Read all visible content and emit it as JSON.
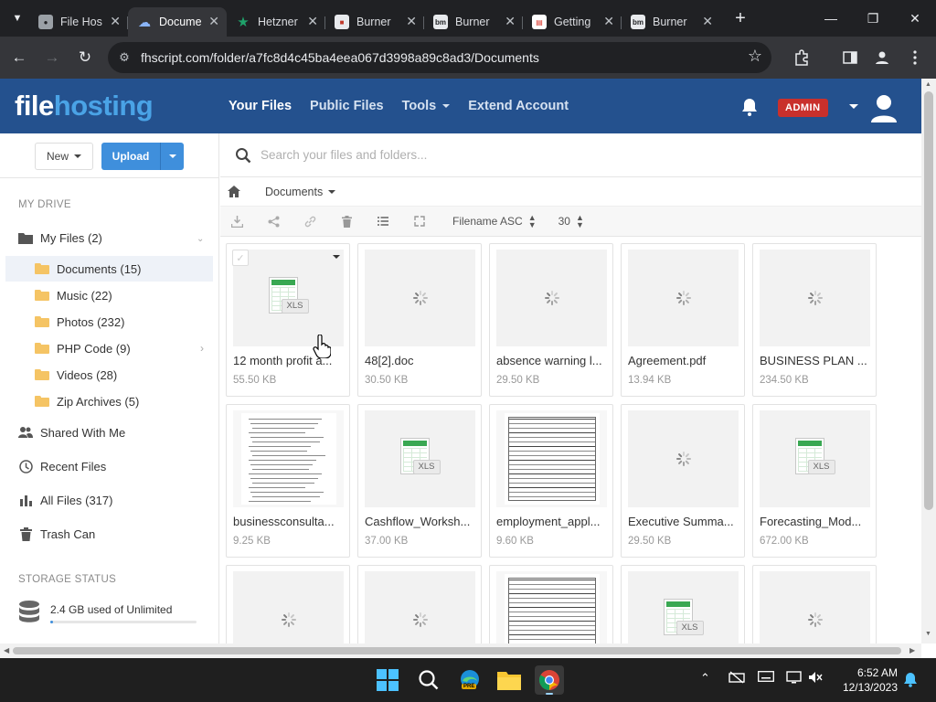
{
  "browser": {
    "tabs": [
      {
        "label": "File Hosting",
        "active": false
      },
      {
        "label": "Documents",
        "active": true
      },
      {
        "label": "Hetzner",
        "active": false
      },
      {
        "label": "Burner",
        "active": false
      },
      {
        "label": "Burner",
        "active": false
      },
      {
        "label": "Getting",
        "active": false
      },
      {
        "label": "Burner",
        "active": false
      }
    ],
    "tab_favicons": {
      "t3": "bm",
      "t5": "bm"
    },
    "url": "fhscript.com/folder/a7fc8d4c45ba4eea067d3998a89c8ad3/Documents"
  },
  "header": {
    "logo_part1": "file",
    "logo_part2": "hosting",
    "nav": [
      "Your Files",
      "Public Files",
      "Tools",
      "Extend Account"
    ],
    "admin_badge": "ADMIN"
  },
  "sidebar": {
    "new_label": "New",
    "upload_label": "Upload",
    "section_drive": "MY DRIVE",
    "my_files": "My Files (2)",
    "folders": [
      {
        "label": "Documents (15)",
        "selected": true
      },
      {
        "label": "Music (22)"
      },
      {
        "label": "Photos (232)"
      },
      {
        "label": "PHP Code (9)"
      },
      {
        "label": "Videos (28)"
      },
      {
        "label": "Zip Archives (5)"
      }
    ],
    "shared": "Shared With Me",
    "recent": "Recent Files",
    "all_files": "All Files (317)",
    "trash": "Trash Can",
    "section_storage": "STORAGE STATUS",
    "storage_text": "2.4 GB used of Unlimited",
    "storage_fraction": 0.02
  },
  "main": {
    "search_placeholder": "Search your files and folders...",
    "breadcrumb": "Documents",
    "sort_label": "Filename ASC",
    "per_page": "30"
  },
  "files": [
    {
      "name": "12 month profit a...",
      "size": "55.50 KB",
      "thumb": "xls"
    },
    {
      "name": "48[2].doc",
      "size": "30.50 KB",
      "thumb": "loading"
    },
    {
      "name": "absence warning l...",
      "size": "29.50 KB",
      "thumb": "loading"
    },
    {
      "name": "Agreement.pdf",
      "size": "13.94 KB",
      "thumb": "loading"
    },
    {
      "name": "BUSINESS PLAN ...",
      "size": "234.50 KB",
      "thumb": "loading"
    },
    {
      "name": "businessconsulta...",
      "size": "9.25 KB",
      "thumb": "doc"
    },
    {
      "name": "Cashflow_Worksh...",
      "size": "37.00 KB",
      "thumb": "xls"
    },
    {
      "name": "employment_appl...",
      "size": "9.60 KB",
      "thumb": "form"
    },
    {
      "name": "Executive Summa...",
      "size": "29.50 KB",
      "thumb": "loading"
    },
    {
      "name": "Forecasting_Mod...",
      "size": "672.00 KB",
      "thumb": "xls"
    },
    {
      "name": "",
      "size": "",
      "thumb": "loading"
    },
    {
      "name": "",
      "size": "",
      "thumb": "loading"
    },
    {
      "name": "",
      "size": "",
      "thumb": "form"
    },
    {
      "name": "",
      "size": "",
      "thumb": "xls"
    },
    {
      "name": "",
      "size": "",
      "thumb": "loading"
    }
  ],
  "xls_label": "XLS",
  "taskbar": {
    "time": "6:52 AM",
    "date": "12/13/2023",
    "edge_badge": "PRE"
  },
  "colors": {
    "header_bg": "#24518e",
    "upload_btn": "#3f8fdc",
    "admin_badge": "#c9302c",
    "selected_row": "#eef2f8"
  }
}
